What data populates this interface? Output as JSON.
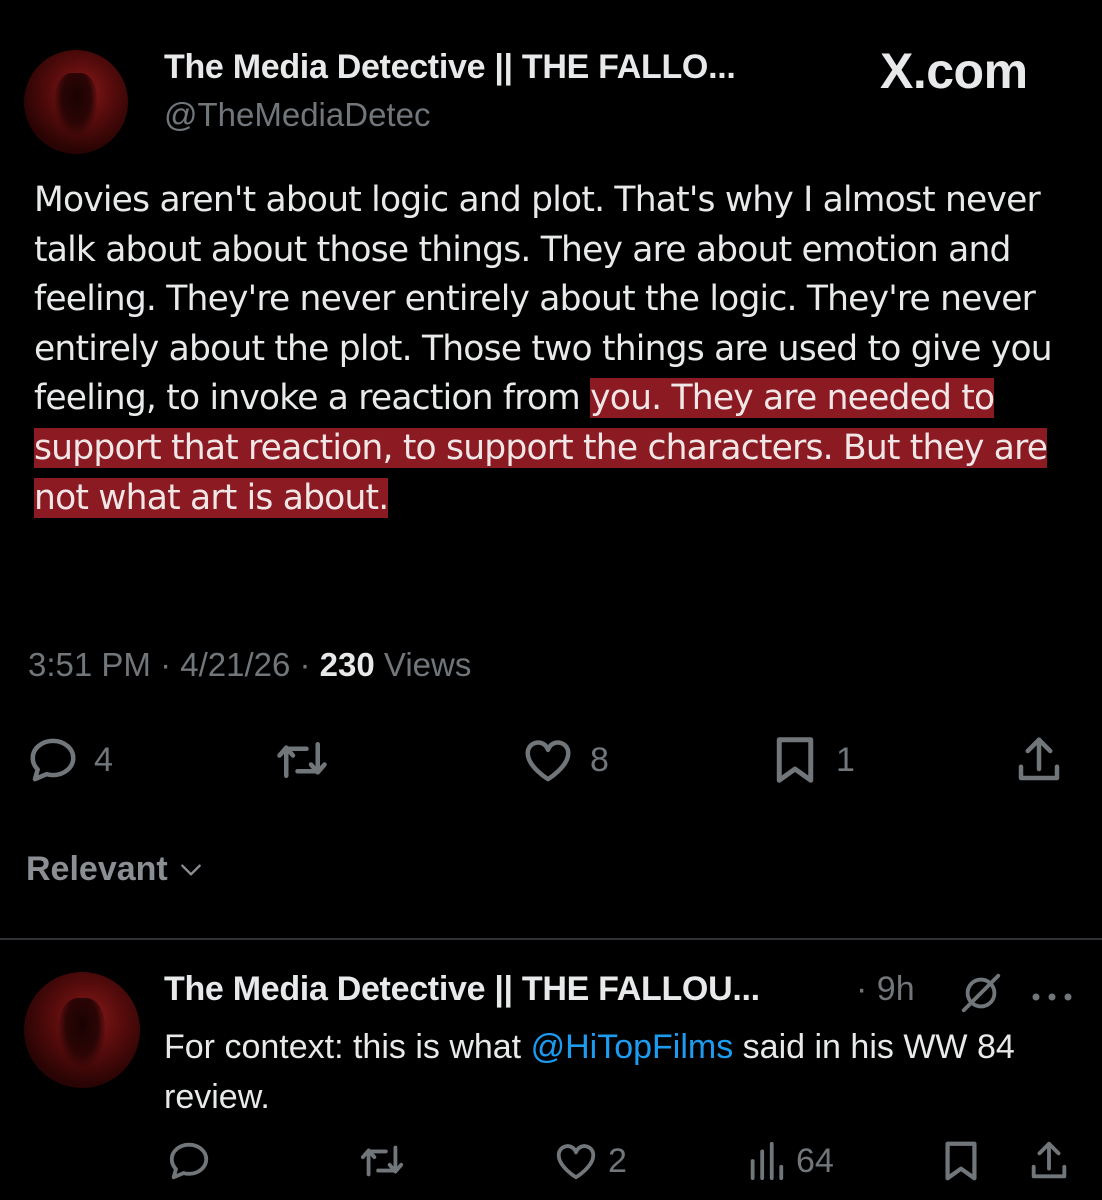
{
  "header": {
    "author_name": "The Media Detective || THE FALLO...",
    "author_handle": "@TheMediaDetec",
    "site": "X.com"
  },
  "tweet": {
    "text_before": "Movies aren't about logic and plot. That's why I almost never talk about about those things. They are about emotion and feeling. They're never entirely about the logic. They're never entirely about the plot. Those two things are used to give you feeling, to invoke a reaction from ",
    "text_highlighted": "you. They are needed to support that reaction, to support the characters. But they are not what art is about.",
    "time": "3:51 PM",
    "date": "4/21/26",
    "views_count": "230",
    "views_label": "Views",
    "replies": "4",
    "likes": "8",
    "bookmarks": "1"
  },
  "sort": {
    "label": "Relevant"
  },
  "reply": {
    "author_name": "The Media Detective || THE FALLOU...",
    "time": "9h",
    "text_before": "For context: this is what ",
    "mention": "@HiTopFilms",
    "text_after": " said in his WW 84 review.",
    "likes": "2",
    "views": "64"
  },
  "colors": {
    "background": "#000000",
    "text": "#e7e9ea",
    "muted": "#71767b",
    "highlight": "#8b1a22",
    "link": "#1d9bf0"
  },
  "icons": [
    "reply-icon",
    "retweet-icon",
    "like-icon",
    "bookmark-icon",
    "share-icon",
    "views-icon",
    "grok-icon",
    "more-icon",
    "chevron-down-icon"
  ]
}
